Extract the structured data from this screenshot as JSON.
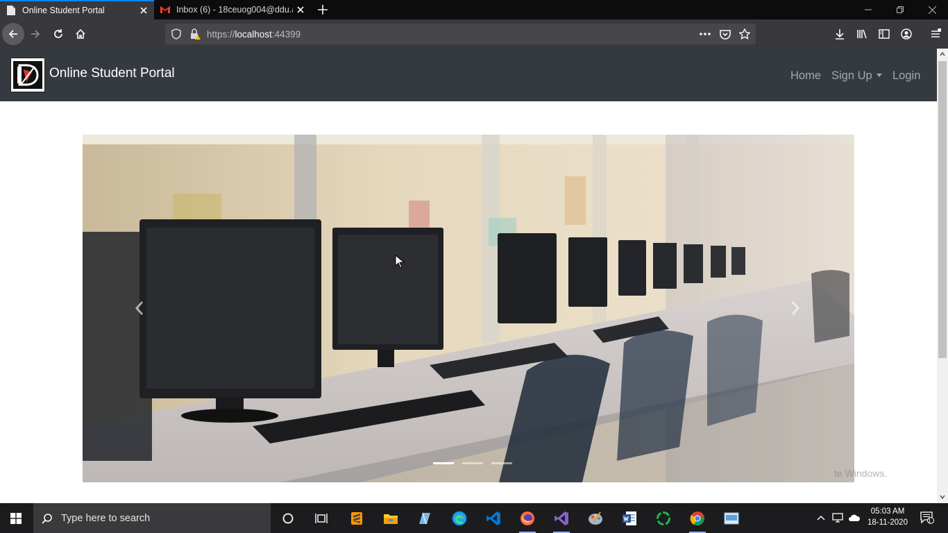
{
  "browser": {
    "tabs": [
      {
        "title": "Online Student Portal",
        "active": true
      },
      {
        "title": "Inbox (6) - 18ceuog004@ddu.a",
        "active": false
      }
    ],
    "url_scheme": "https://",
    "url_host": "localhost",
    "url_port": ":44399"
  },
  "site": {
    "brand": "Online Student Portal",
    "nav": {
      "home": "Home",
      "signup": "Sign Up",
      "login": "Login"
    },
    "carousel": {
      "slide_count": 3,
      "active_index": 0
    },
    "watermark": "te Windows."
  },
  "taskbar": {
    "search_placeholder": "Type here to search",
    "time": "05:03 AM",
    "date": "18-11-2020",
    "notification_count": "1"
  },
  "colors": {
    "navbar_dark": "#343a40",
    "browser_chrome": "#38383d",
    "accent_blue": "#0a84ff",
    "taskbar": "#1c1c1e"
  }
}
